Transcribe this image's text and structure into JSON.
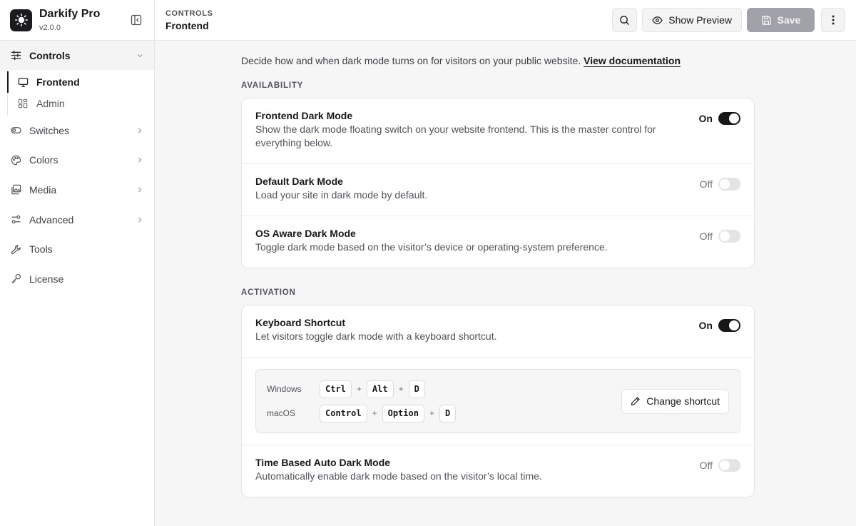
{
  "app": {
    "name": "Darkify Pro",
    "version": "v2.0.0"
  },
  "sidebar": {
    "group": {
      "label": "Controls",
      "icon": "sliders-icon"
    },
    "sub_items": [
      {
        "label": "Frontend",
        "icon": "monitor-icon",
        "active": true
      },
      {
        "label": "Admin",
        "icon": "dashboard-icon",
        "active": false
      }
    ],
    "items": [
      {
        "label": "Switches",
        "icon": "toggle-icon"
      },
      {
        "label": "Colors",
        "icon": "palette-icon"
      },
      {
        "label": "Media",
        "icon": "images-icon"
      },
      {
        "label": "Advanced",
        "icon": "settings-sliders-icon"
      },
      {
        "label": "Tools",
        "icon": "wrench-icon"
      },
      {
        "label": "License",
        "icon": "key-icon"
      }
    ]
  },
  "header": {
    "section": "CONTROLS",
    "page": "Frontend",
    "preview_label": "Show Preview",
    "save_label": "Save"
  },
  "main": {
    "intro_text": "Decide how and when dark mode turns on for visitors on your public website.",
    "intro_link": "View documentation",
    "availability": {
      "title": "AVAILABILITY",
      "rows": [
        {
          "title": "Frontend Dark Mode",
          "desc": "Show the dark mode floating switch on your website frontend. This is the master control for everything below.",
          "state": "On"
        },
        {
          "title": "Default Dark Mode",
          "desc": "Load your site in dark mode by default.",
          "state": "Off"
        },
        {
          "title": "OS Aware Dark Mode",
          "desc": "Toggle dark mode based on the visitor’s device or operating-system preference.",
          "state": "Off"
        }
      ]
    },
    "activation": {
      "title": "ACTIVATION",
      "keyboard": {
        "title": "Keyboard Shortcut",
        "desc": "Let visitors toggle dark mode with a keyboard shortcut.",
        "state": "On"
      },
      "shortcuts": {
        "windows_label": "Windows",
        "windows_keys": [
          "Ctrl",
          "Alt",
          "D"
        ],
        "mac_label": "macOS",
        "mac_keys": [
          "Control",
          "Option",
          "D"
        ],
        "plus": "+",
        "change_label": "Change shortcut"
      },
      "time_based": {
        "title": "Time Based Auto Dark Mode",
        "desc": "Automatically enable dark mode based on the visitor’s local time.",
        "state": "Off"
      }
    }
  }
}
